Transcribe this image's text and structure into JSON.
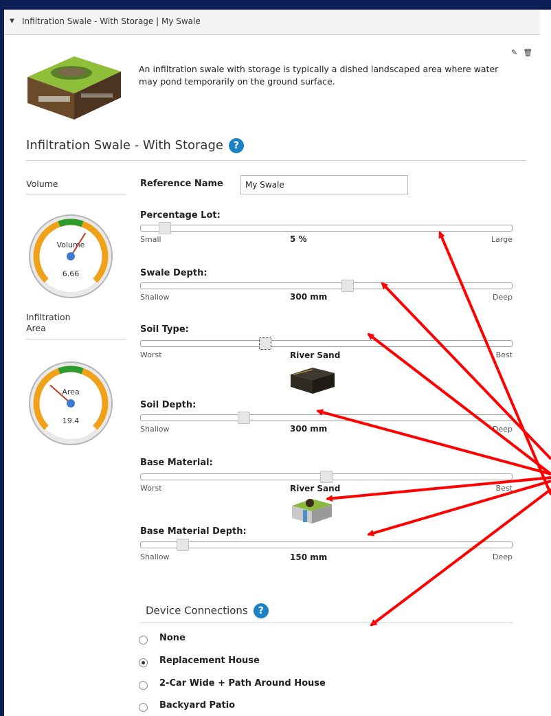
{
  "header": {
    "title": "Infiltration Swale - With Storage | My Swale"
  },
  "description": "An infiltration swale with storage is typically a dished landscaped area where water may pond temporarily on the ground surface.",
  "section": {
    "title": "Infiltration Swale - With Storage",
    "help": "?"
  },
  "volume": {
    "label": "Volume",
    "gauge_title": "Volume",
    "value": "6.66",
    "level": 0.62
  },
  "infiltration_area": {
    "label": "Infiltration\nArea",
    "gauge_title": "Area",
    "value": "19.4",
    "level": 0.32
  },
  "reference": {
    "label": "Reference Name",
    "value": "My Swale"
  },
  "sliders": [
    {
      "id": "percentage_lot",
      "label": "Percentage Lot:",
      "min_label": "Small",
      "max_label": "Large",
      "value": "5 %",
      "position": 0.05
    },
    {
      "id": "swale_depth",
      "label": "Swale Depth:",
      "min_label": "Shallow",
      "max_label": "Deep",
      "value": "300 mm",
      "position": 0.56
    },
    {
      "id": "soil_type",
      "label": "Soil Type:",
      "min_label": "Worst",
      "max_label": "Best",
      "value": "River Sand",
      "position": 0.33
    },
    {
      "id": "soil_depth",
      "label": "Soil Depth:",
      "min_label": "Shallow",
      "max_label": "Deep",
      "value": "300 mm",
      "position": 0.27
    },
    {
      "id": "base_material",
      "label": "Base Material:",
      "min_label": "Worst",
      "max_label": "Best",
      "value": "River Sand",
      "position": 0.5
    },
    {
      "id": "base_material_depth",
      "label": "Base Material Depth:",
      "min_label": "Shallow",
      "max_label": "Deep",
      "value": "150 mm",
      "position": 0.1
    }
  ],
  "device_connections": {
    "title": "Device Connections",
    "options": [
      {
        "label": "None",
        "selected": false
      },
      {
        "label": "Replacement House",
        "selected": true
      },
      {
        "label": "2-Car Wide + Path Around House",
        "selected": false
      },
      {
        "label": "Backyard Patio",
        "selected": false
      }
    ]
  },
  "colors": {
    "background": "#0c1f55",
    "help": "#1b82c5",
    "arrow": "#ff0000",
    "gauge_orange": "#f0a11a",
    "gauge_green": "#2e9b2e"
  }
}
